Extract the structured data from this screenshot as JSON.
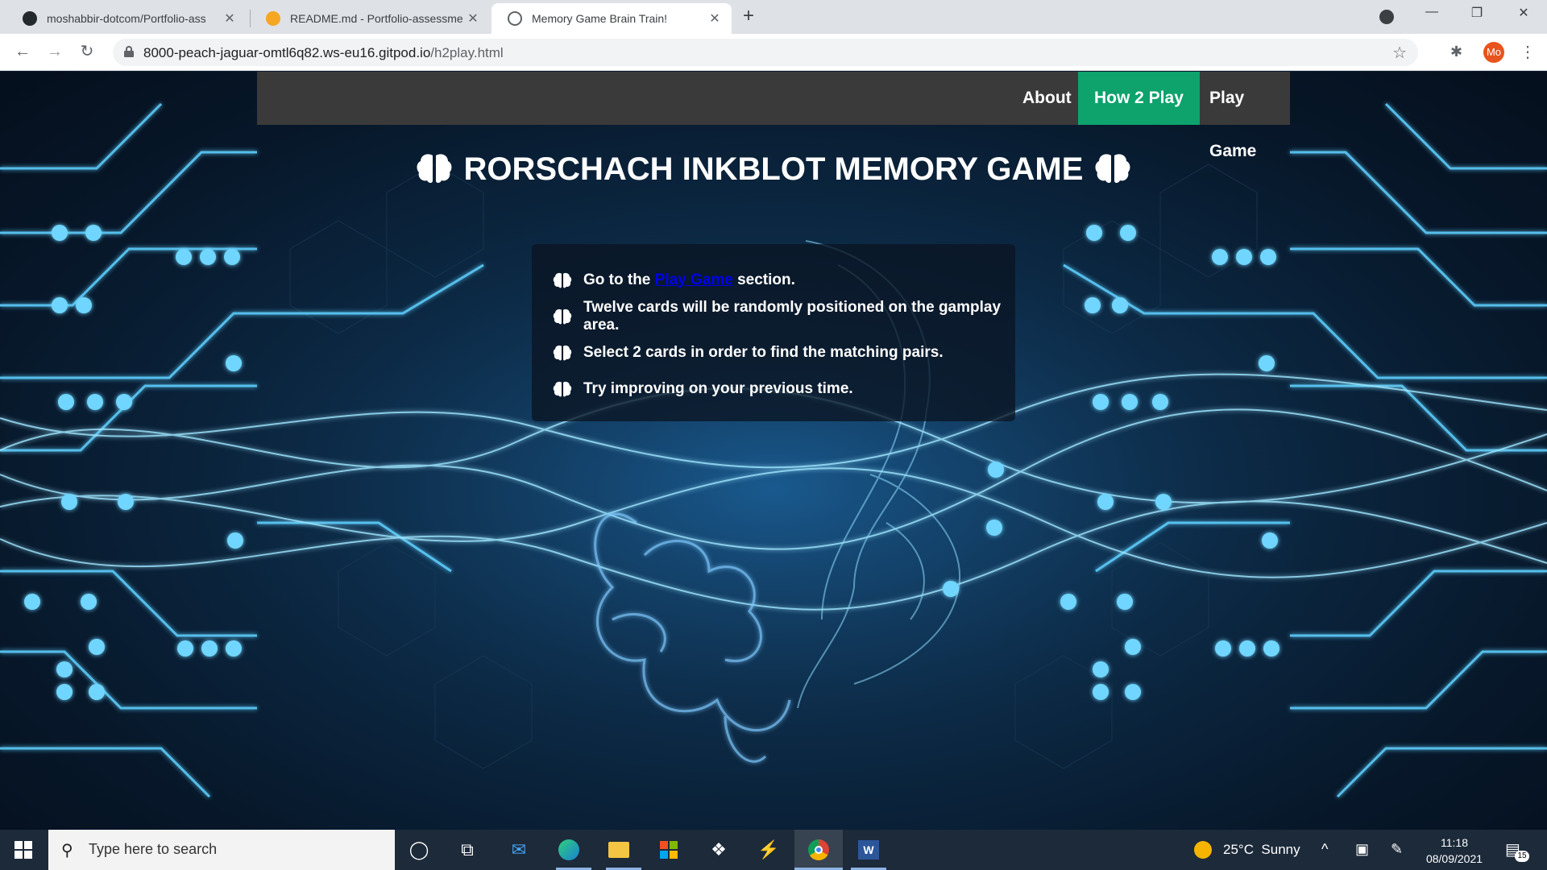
{
  "browser": {
    "tabs": [
      {
        "title": "moshabbir-dotcom/Portfolio-ass",
        "icon": "github-icon",
        "active": false
      },
      {
        "title": "README.md - Portfolio-assessme",
        "icon": "gitpod-icon",
        "active": false
      },
      {
        "title": "Memory Game Brain Train!",
        "icon": "globe-icon",
        "active": true
      }
    ],
    "new_tab": "+",
    "url_host": "8000-peach-jaguar-omtl6q82.ws-eu16.gitpod.io",
    "url_path": "/h2play.html",
    "profile_initials": "Mo"
  },
  "page": {
    "nav": [
      {
        "label": "About",
        "active": false
      },
      {
        "label": "How 2 Play",
        "active": true
      },
      {
        "label": "Play Game",
        "active": false
      }
    ],
    "title": "RORSCHACH INKBLOT MEMORY GAME",
    "instructions": [
      {
        "before": "Go to the ",
        "link": "Play Game",
        "after": " section."
      },
      {
        "text": "Twelve cards will be randomly positioned on the gamplay area."
      },
      {
        "text": "Select 2 cards in order to find the matching pairs."
      },
      {
        "text": "Try improving on your previous time."
      }
    ],
    "colors": {
      "nav_active": "#0ea26c",
      "nav_bg": "#3a3a3a",
      "link": "#0000ee"
    }
  },
  "taskbar": {
    "search_placeholder": "Type here to search",
    "weather": "25°C  Sunny",
    "time": "11:18",
    "date": "08/09/2021",
    "notifications": "15"
  }
}
